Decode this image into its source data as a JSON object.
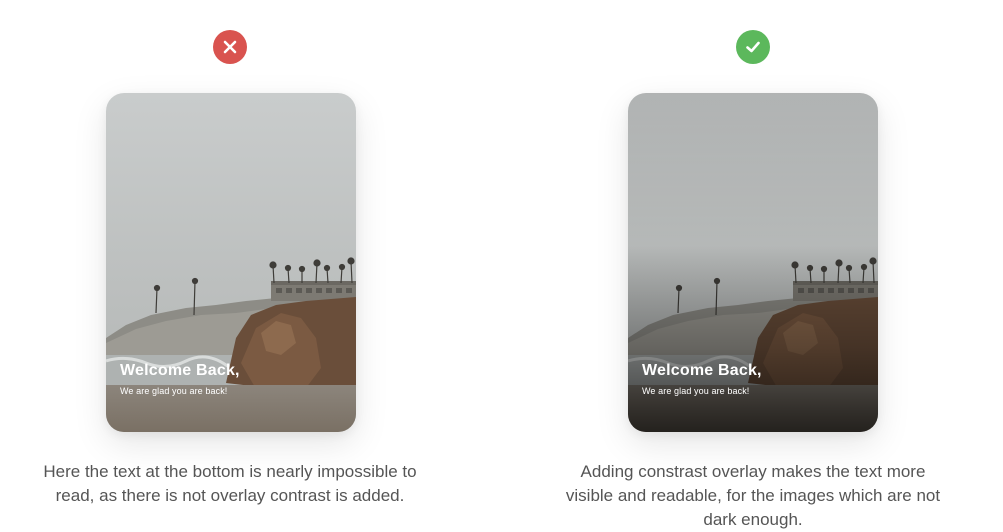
{
  "badges": {
    "bad": {
      "icon": "close-icon",
      "color": "#d9534f"
    },
    "good": {
      "icon": "check-icon",
      "color": "#5cb85c"
    }
  },
  "cards": {
    "bad": {
      "title": "Welcome Back,",
      "subtitle": "We are glad you are back!",
      "overlay": false
    },
    "good": {
      "title": "Welcome Back,",
      "subtitle": "We are glad you are back!",
      "overlay": true
    }
  },
  "captions": {
    "bad": "Here the text at the bottom is nearly impossible to read, as there is not overlay contrast is added.",
    "good": "Adding constrast overlay makes the text more visible and readable, for the images which are not dark enough."
  }
}
